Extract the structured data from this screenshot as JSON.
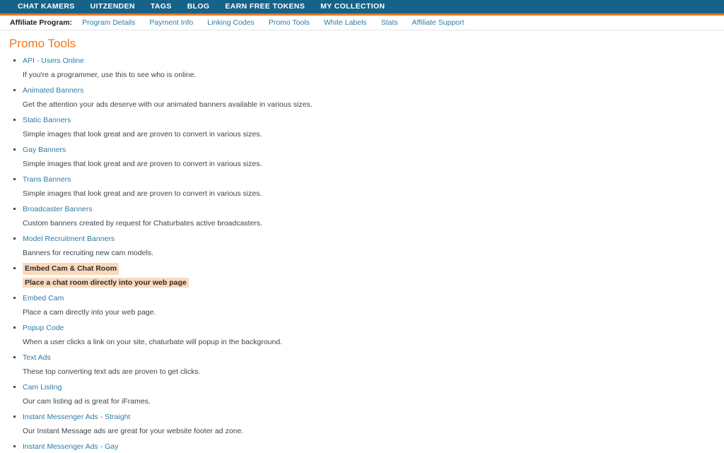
{
  "topbar": {
    "background_color": "#156389",
    "accent_color": "#ea7620",
    "items": [
      {
        "label": "CHAT KAMERS"
      },
      {
        "label": "UITZENDEN"
      },
      {
        "label": "TAGS"
      },
      {
        "label": "BLOG"
      },
      {
        "label": "EARN FREE TOKENS"
      },
      {
        "label": "MY COLLECTION"
      }
    ]
  },
  "affiliate_bar": {
    "label": "Affiliate Program:",
    "link_color": "#2e7ca8",
    "items": [
      {
        "label": "Program Details"
      },
      {
        "label": "Payment Info"
      },
      {
        "label": "Linking Codes"
      },
      {
        "label": "Promo Tools"
      },
      {
        "label": "White Labels"
      },
      {
        "label": "Stats"
      },
      {
        "label": "Affiliate Support"
      }
    ]
  },
  "main": {
    "title": "Promo Tools",
    "title_color": "#f2761c",
    "highlight_color": "#fbd9bd",
    "tools": [
      {
        "name": "API - Users Online",
        "description": "If you're a programmer, use this to see who is online.",
        "highlighted": false
      },
      {
        "name": "Animated Banners",
        "description": "Get the attention your ads deserve with our animated banners available in various sizes.",
        "highlighted": false
      },
      {
        "name": "Static Banners",
        "description": "Simple images that look great and are proven to convert in various sizes.",
        "highlighted": false
      },
      {
        "name": "Gay Banners",
        "description": "Simple images that look great and are proven to convert in various sizes.",
        "highlighted": false
      },
      {
        "name": "Trans Banners",
        "description": "Simple images that look great and are proven to convert in various sizes.",
        "highlighted": false
      },
      {
        "name": "Broadcaster Banners",
        "description": "Custom banners created by request for Chaturbates active broadcasters.",
        "highlighted": false
      },
      {
        "name": "Model Recruitment Banners",
        "description": "Banners for recruiting new cam models.",
        "highlighted": false
      },
      {
        "name": "Embed Cam & Chat Room",
        "description": "Place a chat room directly into your web page",
        "highlighted": true
      },
      {
        "name": "Embed Cam",
        "description": "Place a cam directly into your web page.",
        "highlighted": false
      },
      {
        "name": "Popup Code",
        "description": "When a user clicks a link on your site, chaturbate will popup in the background.",
        "highlighted": false
      },
      {
        "name": "Text Ads",
        "description": "These top converting text ads are proven to get clicks.",
        "highlighted": false
      },
      {
        "name": "Cam Listing",
        "description": "Our cam listing ad is great for iFrames.",
        "highlighted": false
      },
      {
        "name": "Instant Messenger Ads - Straight",
        "description": "Our Instant Message ads are great for your website footer ad zone.",
        "highlighted": false
      },
      {
        "name": "Instant Messenger Ads - Gay",
        "description": "",
        "highlighted": false
      }
    ]
  }
}
